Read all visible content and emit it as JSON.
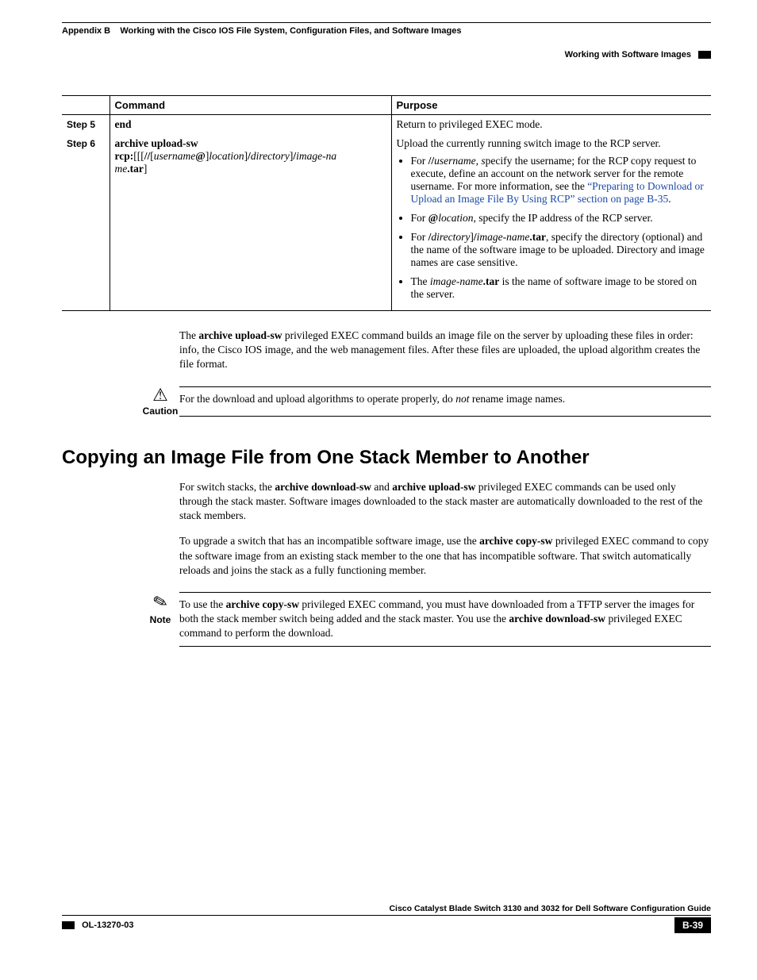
{
  "header": {
    "appendix": "Appendix B",
    "title": "Working with the Cisco IOS File System, Configuration Files, and Software Images",
    "section": "Working with Software Images"
  },
  "table": {
    "headers": {
      "command": "Command",
      "purpose": "Purpose"
    },
    "rows": [
      {
        "step": "Step 5",
        "command_html": "<b>end</b>",
        "purpose_html": "Return to privileged EXEC mode."
      },
      {
        "step": "Step 6",
        "command_html": "<b>archive upload-sw</b><br><b>rcp:</b>[[[<b>//</b>[<i>username</i><b>@</b>]<i>location</i>]<b>/</b><i>directory</i>]<b>/</b><i>image-na<br>me</i><b>.tar</b>]",
        "purpose_html": "Upload the currently running switch image to the RCP server.<ul class=\"bullets\"><li>For <b>//</b><i>username, s</i>pecify the username; for the RCP copy request to execute, define an account on the network server for the remote username. For more information, see the <span class=\"link\">“Preparing to Download or Upload an Image File By Using RCP” section on page B-35</span>.</li><li>For <b>@</b><i>location</i>, specify the IP address of the RCP server.</li><li>For <b>/</b><i>directory</i>]<b>/</b><i>image-name</i><b>.tar</b>, specify the directory (optional) and the name of the software image to be uploaded. Directory and image names are case sensitive.</li><li>The <i>image-name</i><b>.tar</b> is the name of software image to be stored on the server.</li></ul>"
      }
    ]
  },
  "para1_html": "The <b>archive upload-sw</b> privileged EXEC command builds an image file on the server by uploading these files in order: info, the Cisco IOS image, and the web management files. After these files are uploaded, the upload algorithm creates the file format.",
  "caution": {
    "label": "Caution",
    "text_html": "For the download and upload algorithms to operate properly, do <i>not</i> rename image names."
  },
  "section_heading": "Copying an Image File from One Stack Member to Another",
  "para2_html": "For switch stacks, the <b>archive download-sw</b> and <b>archive upload-sw</b> privileged EXEC commands can be used only through the stack master. Software images downloaded to the stack master are automatically downloaded to the rest of the stack members.",
  "para3_html": "To upgrade a switch that has an incompatible software image, use the <b>archive copy-sw</b> privileged EXEC command to copy the software image from an existing stack member to the one that has incompatible software. That switch automatically reloads and joins the stack as a fully functioning member.",
  "note": {
    "label": "Note",
    "text_html": "To use the <b>archive copy-sw</b> privileged EXEC command, you must have downloaded from a TFTP server the images for both the stack member switch being added and the stack master. You use the <b>archive download-sw</b> privileged EXEC command to perform the download."
  },
  "footer": {
    "guide": "Cisco Catalyst Blade Switch 3130 and 3032 for Dell Software Configuration Guide",
    "doc": "OL-13270-03",
    "page": "B-39"
  }
}
